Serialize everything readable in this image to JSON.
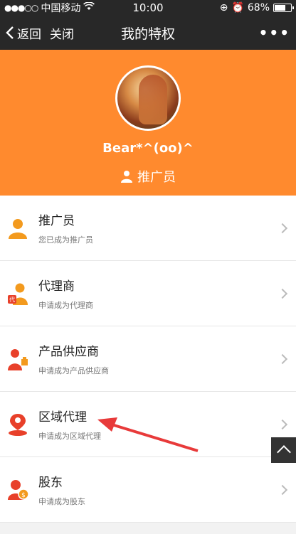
{
  "status_bar": {
    "carrier": "中国移动",
    "time": "10:00",
    "battery_percent": "68%",
    "battery_level": 0.68
  },
  "nav": {
    "back_label": "返回",
    "close_label": "关闭",
    "title": "我的特权",
    "more_label": "•••"
  },
  "profile": {
    "username": "Bear*^(oo)^",
    "role": "推广员"
  },
  "items": [
    {
      "title": "推广员",
      "subtitle": "您已成为推广员"
    },
    {
      "title": "代理商",
      "subtitle": "申请成为代理商"
    },
    {
      "title": "产品供应商",
      "subtitle": "申请成为产品供应商"
    },
    {
      "title": "区域代理",
      "subtitle": "申请成为区域代理"
    },
    {
      "title": "股东",
      "subtitle": "申请成为股东"
    }
  ],
  "colors": {
    "accent": "#ff8a2e",
    "icon_orange": "#f39a1e",
    "icon_red": "#e8402a",
    "nav_bg": "#282828"
  }
}
